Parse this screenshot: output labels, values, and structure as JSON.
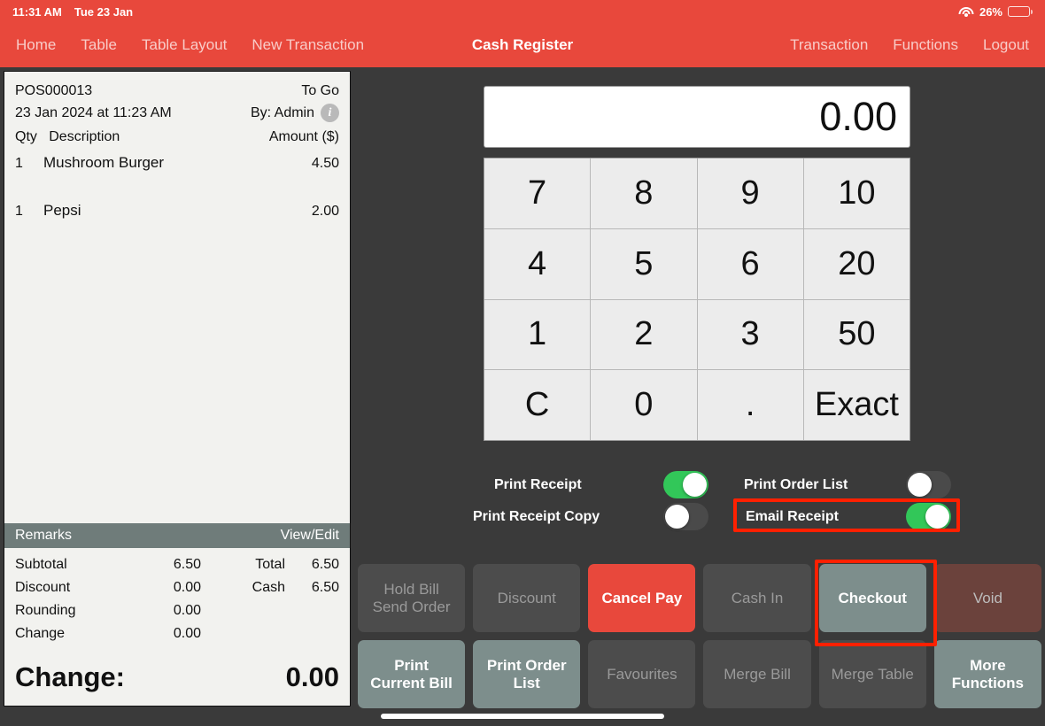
{
  "statusbar": {
    "time": "11:31 AM",
    "date": "Tue 23 Jan",
    "battery_percent": "26%",
    "battery_level": 26,
    "wifi_icon": "wifi-icon",
    "battery_icon": "battery-icon"
  },
  "navbar": {
    "title": "Cash Register",
    "left_items": [
      {
        "label": "Home"
      },
      {
        "label": "Table"
      },
      {
        "label": "Table Layout"
      },
      {
        "label": "New Transaction"
      }
    ],
    "right_items": [
      {
        "label": "Transaction"
      },
      {
        "label": "Functions"
      },
      {
        "label": "Logout"
      }
    ]
  },
  "receipt": {
    "order_no": "POS000013",
    "order_type": "To Go",
    "datetime": "23 Jan 2024 at 11:23 AM",
    "by": "By: Admin",
    "info_icon": "info-icon",
    "col_qty": "Qty",
    "col_description": "Description",
    "col_amount": "Amount ($)",
    "items": [
      {
        "qty": "1",
        "description": "Mushroom Burger",
        "amount": "4.50"
      },
      {
        "qty": "1",
        "description": "Pepsi",
        "amount": "2.00"
      }
    ],
    "remarks_label": "Remarks",
    "remarks_action": "View/Edit",
    "totals": [
      {
        "left_label": "Subtotal",
        "left_value": "6.50",
        "right_label": "Total",
        "right_value": "6.50"
      },
      {
        "left_label": "Discount",
        "left_value": "0.00",
        "right_label": "Cash",
        "right_value": "6.50"
      },
      {
        "left_label": "Rounding",
        "left_value": "0.00",
        "right_label": "",
        "right_value": ""
      },
      {
        "left_label": "Change",
        "left_value": "0.00",
        "right_label": "",
        "right_value": ""
      }
    ],
    "change_label": "Change:",
    "change_value": "0.00"
  },
  "keypad": {
    "display_value": "0.00",
    "keys": [
      "7",
      "8",
      "9",
      "10",
      "4",
      "5",
      "6",
      "20",
      "1",
      "2",
      "3",
      "50",
      "C",
      "0",
      ".",
      "Exact"
    ]
  },
  "toggles": [
    {
      "label": "Print Receipt",
      "state": "on",
      "highlighted": false
    },
    {
      "label": "Print Receipt Copy",
      "state": "off",
      "highlighted": false
    },
    {
      "label": "Print Order List",
      "state": "off",
      "highlighted": false
    },
    {
      "label": "Email Receipt",
      "state": "on",
      "highlighted": true
    }
  ],
  "actions": [
    {
      "label": "Hold Bill\nSend Order",
      "style": "dim",
      "highlighted": false
    },
    {
      "label": "Discount",
      "style": "dim",
      "highlighted": false
    },
    {
      "label": "Cancel Pay",
      "style": "danger",
      "highlighted": false
    },
    {
      "label": "Cash In",
      "style": "dim",
      "highlighted": false
    },
    {
      "label": "Checkout",
      "style": "slate",
      "highlighted": true
    },
    {
      "label": "Void",
      "style": "void",
      "highlighted": false
    },
    {
      "label": "Print\nCurrent Bill",
      "style": "slate",
      "highlighted": false
    },
    {
      "label": "Print Order\nList",
      "style": "slate",
      "highlighted": false
    },
    {
      "label": "Favourites",
      "style": "dim",
      "highlighted": false
    },
    {
      "label": "Merge Bill",
      "style": "dim",
      "highlighted": false
    },
    {
      "label": "Merge Table",
      "style": "dim",
      "highlighted": false
    },
    {
      "label": "More\nFunctions",
      "style": "slate",
      "highlighted": false
    }
  ],
  "colors": {
    "brand_red": "#E8483C",
    "background": "#3a3a3a",
    "toggle_on": "#32C759",
    "highlight": "#FF2000",
    "slate_button": "#7D8E8C",
    "void_button": "#6B423C",
    "remarks_bar": "#6F7C7A",
    "receipt_paper": "#F2F2EF"
  }
}
